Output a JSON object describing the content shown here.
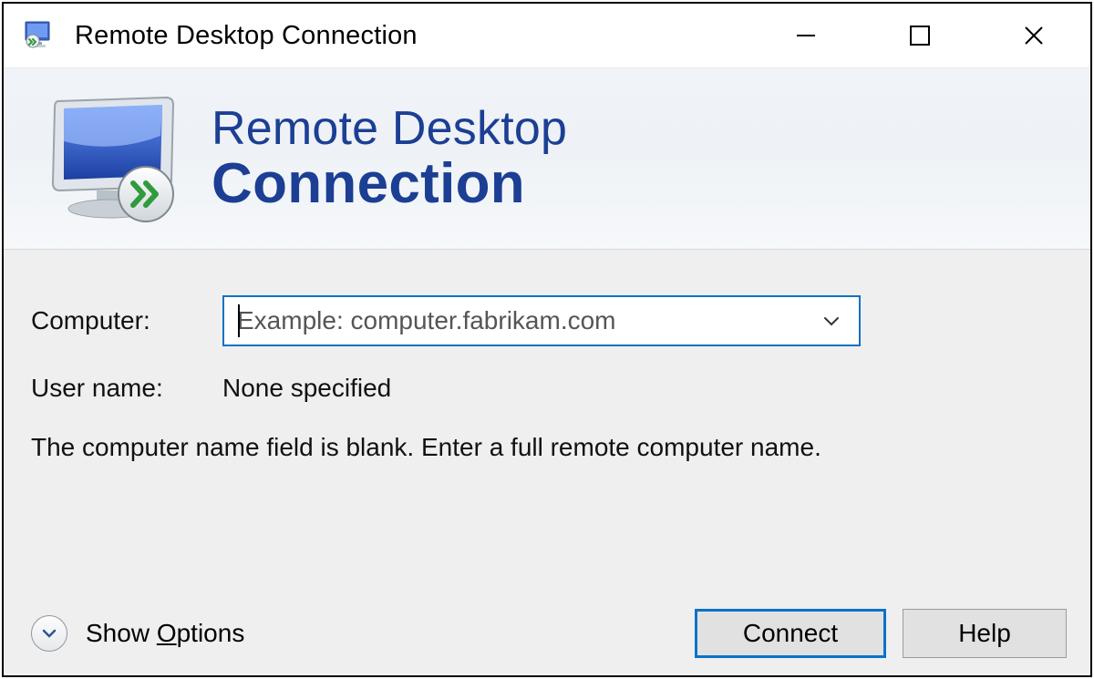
{
  "window": {
    "title": "Remote Desktop Connection"
  },
  "banner": {
    "line1": "Remote Desktop",
    "line2": "Connection"
  },
  "form": {
    "computer_label": "Computer:",
    "computer_placeholder": "Example: computer.fabrikam.com",
    "computer_value": "",
    "username_label": "User name:",
    "username_value": "None specified",
    "hint": "The computer name field is blank. Enter a full remote computer name."
  },
  "footer": {
    "show_options_prefix": "Show ",
    "show_options_accel": "O",
    "show_options_suffix": "ptions",
    "connect_label": "Connect",
    "help_label": "Help"
  },
  "icons": {
    "app": "remote-desktop-icon",
    "minimize": "minimize-icon",
    "maximize": "maximize-icon",
    "close": "close-icon",
    "dropdown": "chevron-down-icon",
    "expand": "chevron-down-circle-icon"
  }
}
